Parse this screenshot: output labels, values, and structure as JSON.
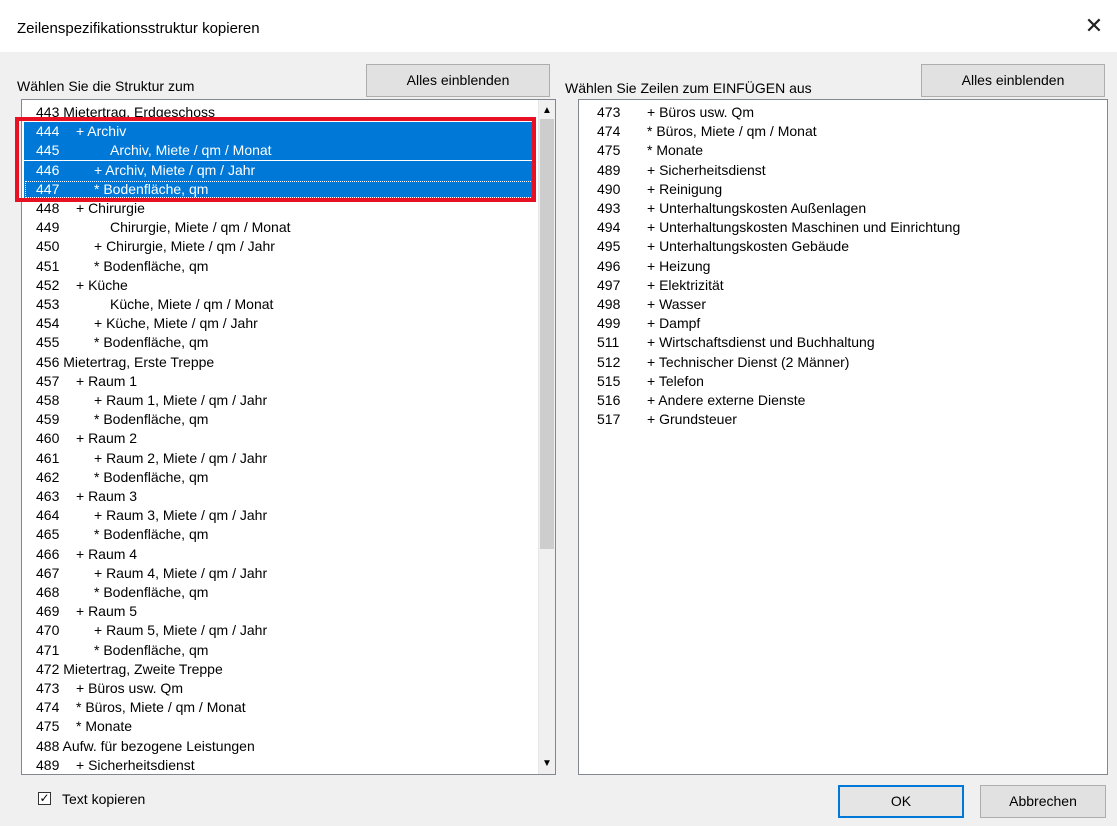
{
  "dialog": {
    "title": "Zeilenspezifikationsstruktur kopieren",
    "close_glyph": "✕"
  },
  "left": {
    "label": "Wählen Sie die Struktur zum",
    "show_all": "Alles einblenden",
    "rows": [
      {
        "num": "",
        "text": "443 Mietertrag, Erdgeschoss",
        "indent": 0,
        "selected": false
      },
      {
        "num": "444",
        "text": "+ Archiv",
        "indent": 1,
        "selected": true
      },
      {
        "num": "445",
        "text": "Archiv, Miete / qm / Monat",
        "indent": 3,
        "selected": true
      },
      {
        "num": "446",
        "text": "+ Archiv, Miete / qm / Jahr",
        "indent": 2,
        "selected": true
      },
      {
        "num": "447",
        "text": "* Bodenfläche, qm",
        "indent": 2,
        "selected": true
      },
      {
        "num": "448",
        "text": "+ Chirurgie",
        "indent": 1,
        "selected": false
      },
      {
        "num": "449",
        "text": "Chirurgie, Miete / qm / Monat",
        "indent": 3,
        "selected": false
      },
      {
        "num": "450",
        "text": "+ Chirurgie, Miete / qm / Jahr",
        "indent": 2,
        "selected": false
      },
      {
        "num": "451",
        "text": "* Bodenfläche, qm",
        "indent": 2,
        "selected": false
      },
      {
        "num": "452",
        "text": "+ Küche",
        "indent": 1,
        "selected": false
      },
      {
        "num": "453",
        "text": "Küche, Miete / qm / Monat",
        "indent": 3,
        "selected": false
      },
      {
        "num": "454",
        "text": "+ Küche, Miete / qm / Jahr",
        "indent": 2,
        "selected": false
      },
      {
        "num": "455",
        "text": "* Bodenfläche, qm",
        "indent": 2,
        "selected": false
      },
      {
        "num": "",
        "text": "456 Mietertrag, Erste Treppe",
        "indent": 0,
        "selected": false
      },
      {
        "num": "457",
        "text": "+ Raum 1",
        "indent": 1,
        "selected": false
      },
      {
        "num": "458",
        "text": "+ Raum 1, Miete / qm / Jahr",
        "indent": 2,
        "selected": false
      },
      {
        "num": "459",
        "text": "* Bodenfläche, qm",
        "indent": 2,
        "selected": false
      },
      {
        "num": "460",
        "text": "+ Raum 2",
        "indent": 1,
        "selected": false
      },
      {
        "num": "461",
        "text": "+ Raum 2, Miete / qm / Jahr",
        "indent": 2,
        "selected": false
      },
      {
        "num": "462",
        "text": "* Bodenfläche, qm",
        "indent": 2,
        "selected": false
      },
      {
        "num": "463",
        "text": "+ Raum 3",
        "indent": 1,
        "selected": false
      },
      {
        "num": "464",
        "text": "+ Raum 3, Miete / qm / Jahr",
        "indent": 2,
        "selected": false
      },
      {
        "num": "465",
        "text": "* Bodenfläche, qm",
        "indent": 2,
        "selected": false
      },
      {
        "num": "466",
        "text": "+ Raum 4",
        "indent": 1,
        "selected": false
      },
      {
        "num": "467",
        "text": "+ Raum 4, Miete / qm / Jahr",
        "indent": 2,
        "selected": false
      },
      {
        "num": "468",
        "text": "* Bodenfläche, qm",
        "indent": 2,
        "selected": false
      },
      {
        "num": "469",
        "text": "+ Raum 5",
        "indent": 1,
        "selected": false
      },
      {
        "num": "470",
        "text": "+ Raum 5, Miete / qm / Jahr",
        "indent": 2,
        "selected": false
      },
      {
        "num": "471",
        "text": "* Bodenfläche, qm",
        "indent": 2,
        "selected": false
      },
      {
        "num": "",
        "text": "472 Mietertrag, Zweite Treppe",
        "indent": 0,
        "selected": false
      },
      {
        "num": "473",
        "text": "+ Büros usw. Qm",
        "indent": 1,
        "selected": false
      },
      {
        "num": "474",
        "text": "* Büros, Miete / qm / Monat",
        "indent": 1,
        "selected": false
      },
      {
        "num": "475",
        "text": "* Monate",
        "indent": 1,
        "selected": false
      },
      {
        "num": "",
        "text": "488 Aufw. für bezogene Leistungen",
        "indent": 0,
        "selected": false
      },
      {
        "num": "489",
        "text": "+ Sicherheitsdienst",
        "indent": 1,
        "selected": false
      }
    ]
  },
  "right": {
    "label": "Wählen Sie Zeilen zum EINFÜGEN aus",
    "show_all": "Alles einblenden",
    "rows": [
      {
        "num": "473",
        "text": "+ Büros usw. Qm"
      },
      {
        "num": "474",
        "text": "* Büros, Miete / qm / Monat"
      },
      {
        "num": "475",
        "text": "* Monate"
      },
      {
        "num": "489",
        "text": "+ Sicherheitsdienst"
      },
      {
        "num": "490",
        "text": "+ Reinigung"
      },
      {
        "num": "493",
        "text": "+ Unterhaltungskosten Außenlagen"
      },
      {
        "num": "494",
        "text": "+ Unterhaltungskosten Maschinen und Einrichtung"
      },
      {
        "num": "495",
        "text": "+ Unterhaltungskosten Gebäude"
      },
      {
        "num": "496",
        "text": "+ Heizung"
      },
      {
        "num": "497",
        "text": "+ Elektrizität"
      },
      {
        "num": "498",
        "text": "+ Wasser"
      },
      {
        "num": "499",
        "text": "+ Dampf"
      },
      {
        "num": "511",
        "text": "+ Wirtschaftsdienst und Buchhaltung"
      },
      {
        "num": "512",
        "text": "+ Technischer Dienst (2 Männer)"
      },
      {
        "num": "515",
        "text": "+ Telefon"
      },
      {
        "num": "516",
        "text": "+ Andere externe Dienste"
      },
      {
        "num": "517",
        "text": "+ Grundsteuer"
      }
    ]
  },
  "footer": {
    "checkbox_label": "Text kopieren",
    "checkbox_checked": true,
    "checkbox_mark": "✓",
    "ok": "OK",
    "cancel": "Abbrechen"
  },
  "icons": {
    "scroll_up": "▲",
    "scroll_down": "▼"
  },
  "colors": {
    "selection": "#0078d7",
    "highlight_box": "#e81123"
  }
}
